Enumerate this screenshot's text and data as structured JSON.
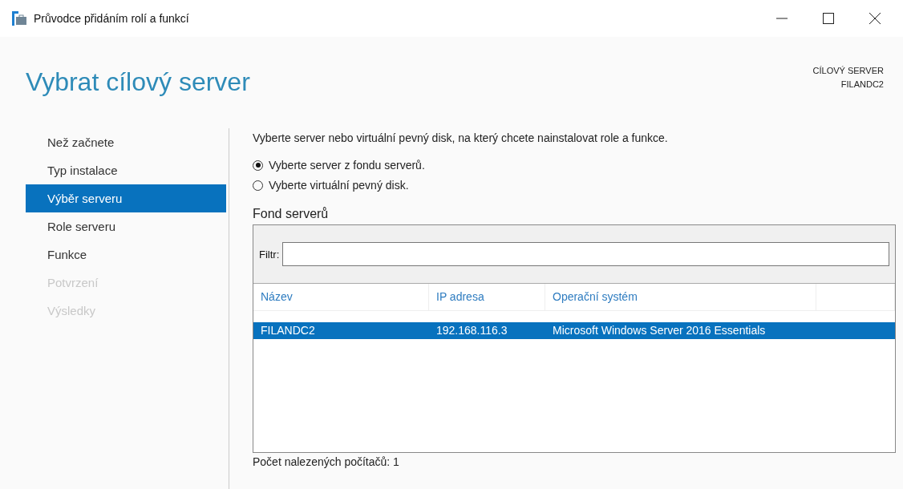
{
  "window": {
    "title": "Průvodce přidáním rolí a funkcí"
  },
  "heading": "Vybrat cílový server",
  "target": {
    "label": "CÍLOVÝ SERVER",
    "server": "FILANDC2"
  },
  "nav": [
    {
      "label": "Než začnete",
      "selected": false,
      "disabled": false
    },
    {
      "label": "Typ instalace",
      "selected": false,
      "disabled": false
    },
    {
      "label": "Výběr serveru",
      "selected": true,
      "disabled": false
    },
    {
      "label": "Role serveru",
      "selected": false,
      "disabled": false
    },
    {
      "label": "Funkce",
      "selected": false,
      "disabled": false
    },
    {
      "label": "Potvrzení",
      "selected": false,
      "disabled": true
    },
    {
      "label": "Výsledky",
      "selected": false,
      "disabled": true
    }
  ],
  "intro": "Vyberte server nebo virtuální pevný disk, na který chcete nainstalovat role a funkce.",
  "options": [
    {
      "label": "Vyberte server z fondu serverů.",
      "selected": true
    },
    {
      "label": "Vyberte virtuální pevný disk.",
      "selected": false
    }
  ],
  "pool": {
    "title": "Fond serverů",
    "filter_label": "Filtr:",
    "columns": [
      "Název",
      "IP adresa",
      "Operační systém"
    ],
    "rows": [
      {
        "cells": [
          "FILANDC2",
          "192.168.116.3",
          "Microsoft Windows Server 2016 Essentials"
        ],
        "selected": true
      }
    ],
    "count": "Počet nalezených počítačů: 1"
  }
}
